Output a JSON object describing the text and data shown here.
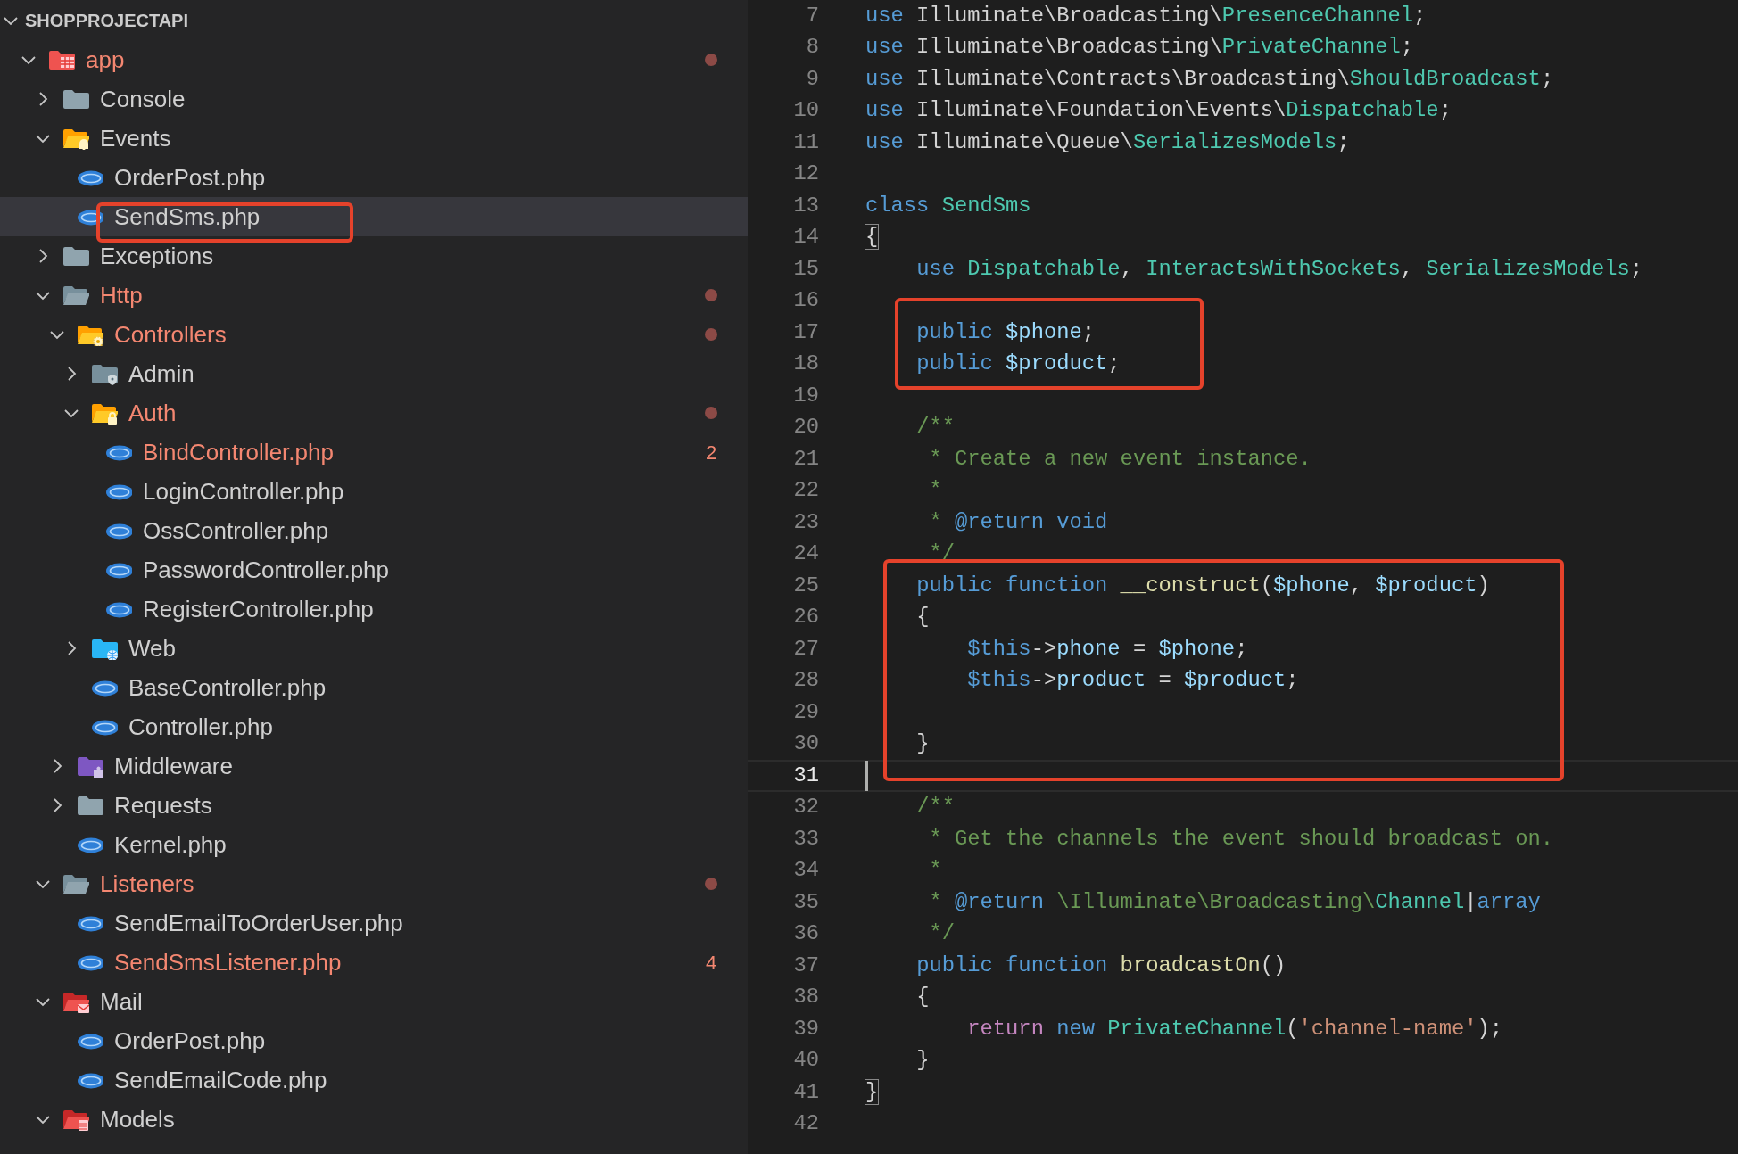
{
  "explorer": {
    "title": "SHOPPROJECTAPI",
    "expanded": true,
    "items": [
      {
        "label": "app",
        "kind": "app-folder",
        "expanded": true,
        "modified": true,
        "selected": false,
        "highlighted": false,
        "children": [
          {
            "label": "Console",
            "kind": "folder",
            "expanded": false,
            "modified": false,
            "selected": false,
            "highlighted": false
          },
          {
            "label": "Events",
            "kind": "events-folder",
            "expanded": true,
            "modified": false,
            "selected": false,
            "highlighted": false,
            "children": [
              {
                "label": "OrderPost.php",
                "kind": "file",
                "modified": false,
                "selected": false,
                "highlighted": false
              },
              {
                "label": "SendSms.php",
                "kind": "file",
                "modified": false,
                "selected": true,
                "highlighted": true
              }
            ]
          },
          {
            "label": "Exceptions",
            "kind": "folder",
            "expanded": false,
            "modified": false,
            "selected": false,
            "highlighted": false
          },
          {
            "label": "Http",
            "kind": "open-folder",
            "expanded": true,
            "modified": true,
            "selected": false,
            "highlighted": false,
            "children": [
              {
                "label": "Controllers",
                "kind": "controllers-folder",
                "expanded": true,
                "modified": true,
                "selected": false,
                "highlighted": false,
                "children": [
                  {
                    "label": "Admin",
                    "kind": "admin-folder",
                    "expanded": false,
                    "modified": false,
                    "selected": false,
                    "highlighted": false
                  },
                  {
                    "label": "Auth",
                    "kind": "auth-folder",
                    "expanded": true,
                    "modified": true,
                    "selected": false,
                    "highlighted": false,
                    "children": [
                      {
                        "label": "BindController.php",
                        "kind": "file",
                        "modified": true,
                        "problems": "2",
                        "selected": false,
                        "highlighted": false
                      },
                      {
                        "label": "LoginController.php",
                        "kind": "file",
                        "modified": false,
                        "selected": false,
                        "highlighted": false
                      },
                      {
                        "label": "OssController.php",
                        "kind": "file",
                        "modified": false,
                        "selected": false,
                        "highlighted": false
                      },
                      {
                        "label": "PasswordController.php",
                        "kind": "file",
                        "modified": false,
                        "selected": false,
                        "highlighted": false
                      },
                      {
                        "label": "RegisterController.php",
                        "kind": "file",
                        "modified": false,
                        "selected": false,
                        "highlighted": false
                      }
                    ]
                  },
                  {
                    "label": "Web",
                    "kind": "web-folder",
                    "expanded": false,
                    "modified": false,
                    "selected": false,
                    "highlighted": false
                  },
                  {
                    "label": "BaseController.php",
                    "kind": "file",
                    "modified": false,
                    "selected": false,
                    "highlighted": false
                  },
                  {
                    "label": "Controller.php",
                    "kind": "file",
                    "modified": false,
                    "selected": false,
                    "highlighted": false
                  }
                ]
              },
              {
                "label": "Middleware",
                "kind": "middleware-folder",
                "expanded": false,
                "modified": false,
                "selected": false,
                "highlighted": false
              },
              {
                "label": "Requests",
                "kind": "folder",
                "expanded": false,
                "modified": false,
                "selected": false,
                "highlighted": false
              },
              {
                "label": "Kernel.php",
                "kind": "file",
                "modified": false,
                "selected": false,
                "highlighted": false
              }
            ]
          },
          {
            "label": "Listeners",
            "kind": "open-folder",
            "expanded": true,
            "modified": true,
            "selected": false,
            "highlighted": false,
            "children": [
              {
                "label": "SendEmailToOrderUser.php",
                "kind": "file",
                "modified": false,
                "selected": false,
                "highlighted": false
              },
              {
                "label": "SendSmsListener.php",
                "kind": "file",
                "modified": true,
                "problems": "4",
                "selected": false,
                "highlighted": false
              }
            ]
          },
          {
            "label": "Mail",
            "kind": "mail-folder",
            "expanded": true,
            "modified": false,
            "selected": false,
            "highlighted": false,
            "children": [
              {
                "label": "OrderPost.php",
                "kind": "file",
                "modified": false,
                "selected": false,
                "highlighted": false
              },
              {
                "label": "SendEmailCode.php",
                "kind": "file",
                "modified": false,
                "selected": false,
                "highlighted": false
              }
            ]
          },
          {
            "label": "Models",
            "kind": "models-folder",
            "expanded": true,
            "modified": false,
            "selected": false,
            "highlighted": false
          }
        ]
      }
    ]
  },
  "editor": {
    "lines": [
      {
        "number": "7",
        "current": false,
        "boxed": false,
        "tokens": [
          {
            "kind": "keyword",
            "text": "use"
          },
          {
            "kind": "plain",
            "text": " Illuminate\\Broadcasting\\"
          },
          {
            "kind": "type",
            "text": "PresenceChannel"
          },
          {
            "kind": "plain",
            "text": ";"
          }
        ]
      },
      {
        "number": "8",
        "current": false,
        "boxed": false,
        "tokens": [
          {
            "kind": "keyword",
            "text": "use"
          },
          {
            "kind": "plain",
            "text": " Illuminate\\Broadcasting\\"
          },
          {
            "kind": "type",
            "text": "PrivateChannel"
          },
          {
            "kind": "plain",
            "text": ";"
          }
        ]
      },
      {
        "number": "9",
        "current": false,
        "boxed": false,
        "tokens": [
          {
            "kind": "keyword",
            "text": "use"
          },
          {
            "kind": "plain",
            "text": " Illuminate\\Contracts\\Broadcasting\\"
          },
          {
            "kind": "type",
            "text": "ShouldBroadcast"
          },
          {
            "kind": "plain",
            "text": ";"
          }
        ]
      },
      {
        "number": "10",
        "current": false,
        "boxed": false,
        "tokens": [
          {
            "kind": "keyword",
            "text": "use"
          },
          {
            "kind": "plain",
            "text": " Illuminate\\Foundation\\Events\\"
          },
          {
            "kind": "type",
            "text": "Dispatchable"
          },
          {
            "kind": "plain",
            "text": ";"
          }
        ]
      },
      {
        "number": "11",
        "current": false,
        "boxed": false,
        "tokens": [
          {
            "kind": "keyword",
            "text": "use"
          },
          {
            "kind": "plain",
            "text": " Illuminate\\Queue\\"
          },
          {
            "kind": "type",
            "text": "SerializesModels"
          },
          {
            "kind": "plain",
            "text": ";"
          }
        ]
      },
      {
        "number": "12",
        "current": false,
        "boxed": false
      },
      {
        "number": "13",
        "current": false,
        "boxed": false,
        "tokens": [
          {
            "kind": "keyword",
            "text": "class"
          },
          {
            "kind": "type",
            "text": " SendSms"
          }
        ]
      },
      {
        "number": "14",
        "current": false,
        "boxed": false,
        "tokens": [
          {
            "kind": "bracket",
            "text": "{"
          }
        ]
      },
      {
        "number": "15",
        "current": false,
        "boxed": false,
        "tokens": [
          {
            "kind": "keyword",
            "text": "    use"
          },
          {
            "kind": "type",
            "text": " Dispatchable"
          },
          {
            "kind": "plain",
            "text": ", "
          },
          {
            "kind": "type",
            "text": "InteractsWithSockets"
          },
          {
            "kind": "plain",
            "text": ", "
          },
          {
            "kind": "type",
            "text": "SerializesModels"
          },
          {
            "kind": "plain",
            "text": ";"
          }
        ]
      },
      {
        "number": "16",
        "current": false,
        "boxed": false
      },
      {
        "number": "17",
        "current": false,
        "boxed": true,
        "tokens": [
          {
            "kind": "keyword",
            "text": "    public"
          },
          {
            "kind": "variable",
            "text": " $phone"
          },
          {
            "kind": "plain",
            "text": ";"
          }
        ]
      },
      {
        "number": "18",
        "current": false,
        "boxed": true,
        "tokens": [
          {
            "kind": "keyword",
            "text": "    public"
          },
          {
            "kind": "variable",
            "text": " $product"
          },
          {
            "kind": "plain",
            "text": ";"
          }
        ]
      },
      {
        "number": "19",
        "current": false,
        "boxed": false
      },
      {
        "number": "20",
        "current": false,
        "boxed": false,
        "tokens": [
          {
            "kind": "comment",
            "text": "    /**"
          }
        ]
      },
      {
        "number": "21",
        "current": false,
        "boxed": false,
        "tokens": [
          {
            "kind": "comment",
            "text": "     * Create a new event instance."
          }
        ]
      },
      {
        "number": "22",
        "current": false,
        "boxed": false,
        "tokens": [
          {
            "kind": "comment",
            "text": "     *"
          }
        ]
      },
      {
        "number": "23",
        "current": false,
        "boxed": false,
        "tokens": [
          {
            "kind": "comment",
            "text": "     * "
          },
          {
            "kind": "keyword",
            "text": "@return"
          },
          {
            "kind": "keyword",
            "text": " void"
          }
        ]
      },
      {
        "number": "24",
        "current": false,
        "boxed": false,
        "tokens": [
          {
            "kind": "comment",
            "text": "     */"
          }
        ]
      },
      {
        "number": "25",
        "current": false,
        "boxed": true,
        "tokens": [
          {
            "kind": "keyword",
            "text": "    public function"
          },
          {
            "kind": "function",
            "text": " __construct"
          },
          {
            "kind": "plain",
            "text": "("
          },
          {
            "kind": "variable",
            "text": "$phone"
          },
          {
            "kind": "plain",
            "text": ", "
          },
          {
            "kind": "variable",
            "text": "$product"
          },
          {
            "kind": "plain",
            "text": ")"
          }
        ]
      },
      {
        "number": "26",
        "current": false,
        "boxed": true,
        "tokens": [
          {
            "kind": "plain",
            "text": "    {"
          }
        ]
      },
      {
        "number": "27",
        "current": false,
        "boxed": true,
        "tokens": [
          {
            "kind": "keyword",
            "text": "        $this"
          },
          {
            "kind": "plain",
            "text": "->"
          },
          {
            "kind": "variable",
            "text": "phone"
          },
          {
            "kind": "plain",
            "text": " = "
          },
          {
            "kind": "variable",
            "text": "$phone"
          },
          {
            "kind": "plain",
            "text": ";"
          }
        ]
      },
      {
        "number": "28",
        "current": false,
        "boxed": true,
        "tokens": [
          {
            "kind": "keyword",
            "text": "        $this"
          },
          {
            "kind": "plain",
            "text": "->"
          },
          {
            "kind": "variable",
            "text": "product"
          },
          {
            "kind": "plain",
            "text": " = "
          },
          {
            "kind": "variable",
            "text": "$product"
          },
          {
            "kind": "plain",
            "text": ";"
          }
        ]
      },
      {
        "number": "29",
        "current": false,
        "boxed": true
      },
      {
        "number": "30",
        "current": false,
        "boxed": true,
        "tokens": [
          {
            "kind": "plain",
            "text": "    }"
          }
        ]
      },
      {
        "number": "31",
        "current": true,
        "boxed": false
      },
      {
        "number": "32",
        "current": false,
        "boxed": false,
        "tokens": [
          {
            "kind": "comment",
            "text": "    /**"
          }
        ]
      },
      {
        "number": "33",
        "current": false,
        "boxed": false,
        "tokens": [
          {
            "kind": "comment",
            "text": "     * Get the channels the event should broadcast on."
          }
        ]
      },
      {
        "number": "34",
        "current": false,
        "boxed": false,
        "tokens": [
          {
            "kind": "comment",
            "text": "     *"
          }
        ]
      },
      {
        "number": "35",
        "current": false,
        "boxed": false,
        "tokens": [
          {
            "kind": "comment",
            "text": "     * "
          },
          {
            "kind": "keyword",
            "text": "@return"
          },
          {
            "kind": "comment",
            "text": " \\Illuminate\\Broadcasting\\"
          },
          {
            "kind": "type",
            "text": "Channel"
          },
          {
            "kind": "plain",
            "text": "|"
          },
          {
            "kind": "keyword",
            "text": "array"
          }
        ]
      },
      {
        "number": "36",
        "current": false,
        "boxed": false,
        "tokens": [
          {
            "kind": "comment",
            "text": "     */"
          }
        ]
      },
      {
        "number": "37",
        "current": false,
        "boxed": false,
        "tokens": [
          {
            "kind": "keyword",
            "text": "    public function"
          },
          {
            "kind": "function",
            "text": " broadcastOn"
          },
          {
            "kind": "plain",
            "text": "()"
          }
        ]
      },
      {
        "number": "38",
        "current": false,
        "boxed": false,
        "tokens": [
          {
            "kind": "plain",
            "text": "    {"
          }
        ]
      },
      {
        "number": "39",
        "current": false,
        "boxed": false,
        "tokens": [
          {
            "kind": "control",
            "text": "        return"
          },
          {
            "kind": "keyword",
            "text": " new"
          },
          {
            "kind": "type",
            "text": " PrivateChannel"
          },
          {
            "kind": "plain",
            "text": "("
          },
          {
            "kind": "string",
            "text": "'channel-name'"
          },
          {
            "kind": "plain",
            "text": ");"
          }
        ]
      },
      {
        "number": "40",
        "current": false,
        "boxed": false,
        "tokens": [
          {
            "kind": "plain",
            "text": "    }"
          }
        ]
      },
      {
        "number": "41",
        "current": false,
        "boxed": false,
        "tokens": [
          {
            "kind": "bracket",
            "text": "}"
          }
        ]
      },
      {
        "number": "42",
        "current": false,
        "boxed": false
      }
    ]
  }
}
